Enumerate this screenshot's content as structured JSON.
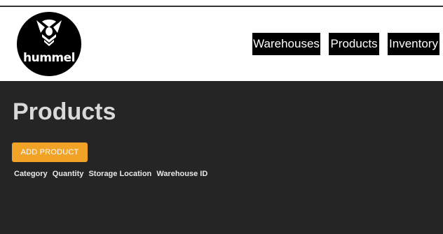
{
  "brand": {
    "logo_text": "hummel",
    "icon": "hummel-bee-logo-icon"
  },
  "nav": {
    "items": [
      {
        "label": "Warehouses"
      },
      {
        "label": "Products"
      },
      {
        "label": "Inventory"
      }
    ]
  },
  "main": {
    "title": "Products",
    "add_button_label": "ADD PRODUCT",
    "table_headers": [
      "Category",
      "Quantity",
      "Storage Location",
      "Warehouse ID"
    ]
  },
  "colors": {
    "header_bg": "#ffffff",
    "nav_bg": "#000000",
    "main_bg": "#252525",
    "accent": "#f1a327",
    "title_text": "#d9d9d9"
  }
}
